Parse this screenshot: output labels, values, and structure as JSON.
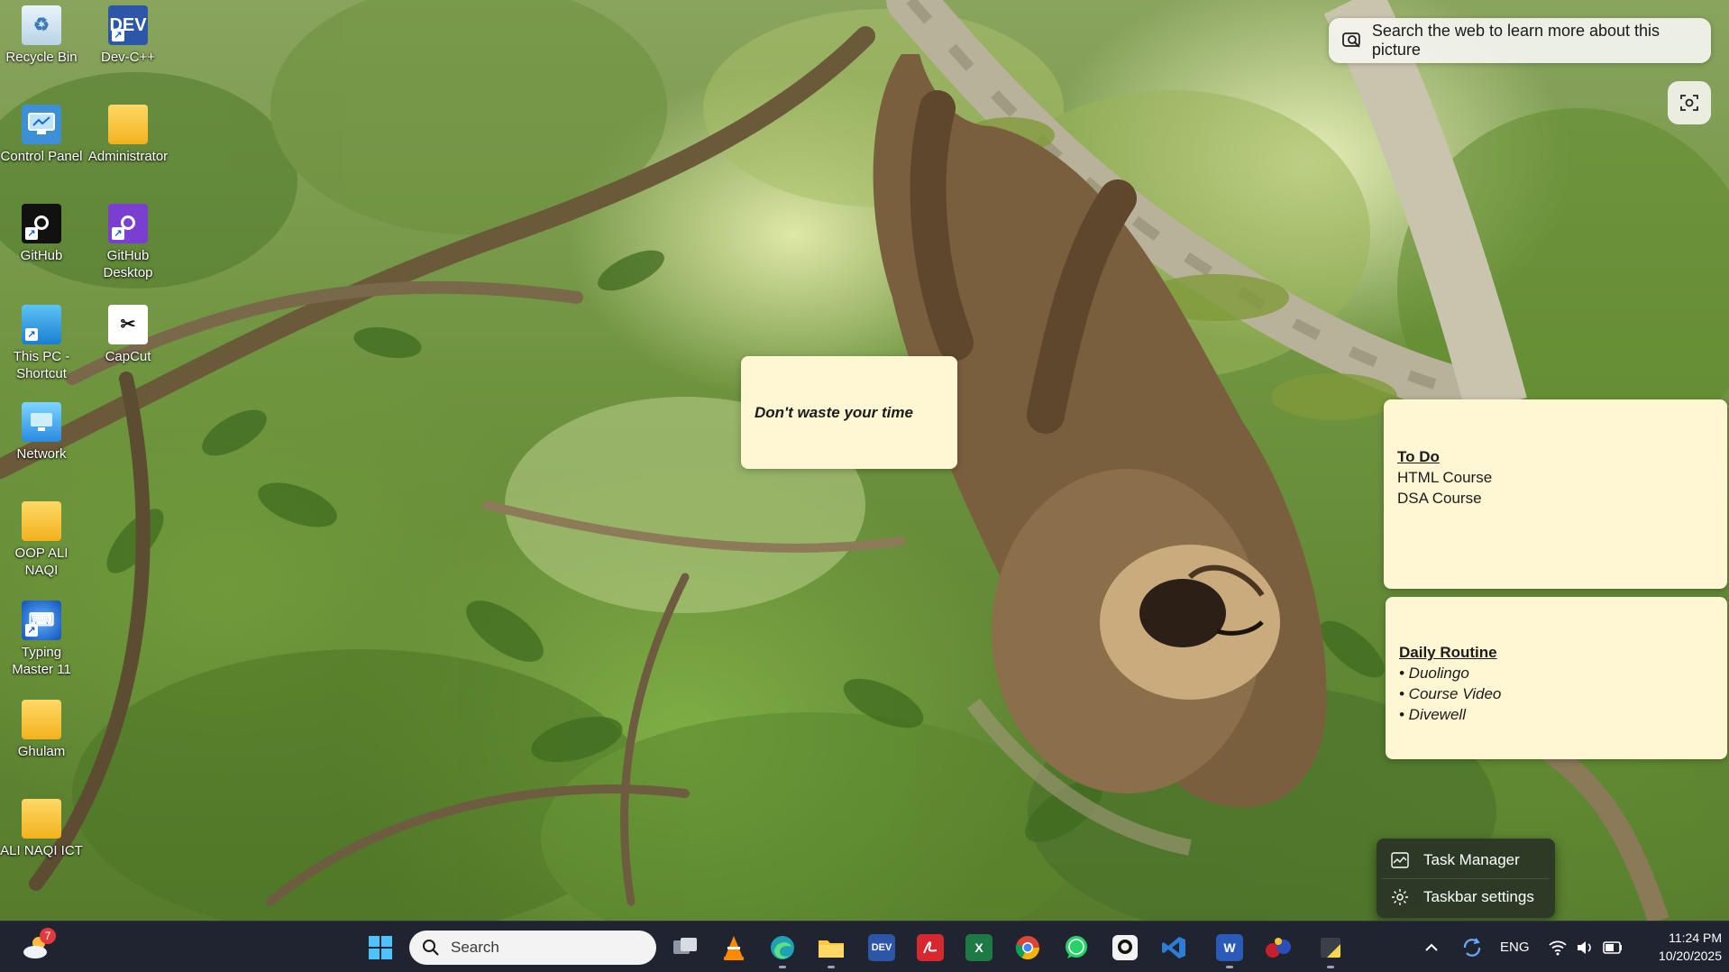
{
  "desktop": {
    "icons": [
      {
        "label": "Recycle Bin",
        "icon": "recycle-bin-icon"
      },
      {
        "label": "Dev-C++",
        "icon": "devcpp-icon",
        "glyph": "DEV"
      },
      {
        "label": "Control Panel",
        "icon": "control-panel-icon"
      },
      {
        "label": "Administrator",
        "icon": "user-folder-icon"
      },
      {
        "label": "GitHub",
        "icon": "github-icon"
      },
      {
        "label": "GitHub Desktop",
        "icon": "github-desktop-icon"
      },
      {
        "label": "This PC - Shortcut",
        "icon": "this-pc-icon"
      },
      {
        "label": "CapCut",
        "icon": "capcut-icon"
      },
      {
        "label": "Network",
        "icon": "network-icon"
      },
      {
        "label": "OOP ALI NAQI",
        "icon": "folder-icon"
      },
      {
        "label": "Typing Master 11",
        "icon": "typing-master-icon"
      },
      {
        "label": "Ghulam",
        "icon": "folder-icon"
      },
      {
        "label": "ALI NAQI ICT",
        "icon": "folder-icon"
      }
    ]
  },
  "bing": {
    "search_label": "Search the web to learn more about this picture"
  },
  "notes": {
    "quote": "Don't waste your time",
    "todo": {
      "heading": "To Do",
      "items": [
        "HTML Course",
        "DSA Course"
      ]
    },
    "routine": {
      "heading": "Daily Routine",
      "items": [
        "• Duolingo",
        "• Course Video",
        "• Divewell"
      ]
    }
  },
  "context_menu": {
    "items": [
      {
        "label": "Task Manager",
        "icon": "task-manager-icon"
      },
      {
        "label": "Taskbar settings",
        "icon": "gear-icon"
      }
    ]
  },
  "taskbar": {
    "weather_badge": "7",
    "search_placeholder": "Search",
    "apps": [
      {
        "name": "task-view",
        "color": "#d8dbe2"
      },
      {
        "name": "vlc",
        "color": "#ff8a00"
      },
      {
        "name": "edge",
        "color": "#1fa0b4"
      },
      {
        "name": "file-explorer",
        "color": "#ffc83d"
      },
      {
        "name": "devcpp",
        "color": "#2c56a8",
        "glyph": "DEV"
      },
      {
        "name": "acrobat",
        "color": "#d7282f"
      },
      {
        "name": "excel",
        "color": "#1d7a45",
        "glyph": "X"
      },
      {
        "name": "chrome",
        "color": "#4285f4"
      },
      {
        "name": "whatsapp",
        "color": "#25d366"
      },
      {
        "name": "github",
        "color": "#f2f2f2"
      },
      {
        "name": "vscode",
        "color": "#2d7cd6"
      },
      {
        "name": "word",
        "color": "#2b5bb8",
        "glyph": "W"
      },
      {
        "name": "game",
        "color": "#c8202a"
      },
      {
        "name": "sticky-notes",
        "color": "#f7d84a"
      }
    ],
    "tray": {
      "language": "ENG",
      "time": "11:24 PM",
      "date": "10/20/2025"
    }
  }
}
